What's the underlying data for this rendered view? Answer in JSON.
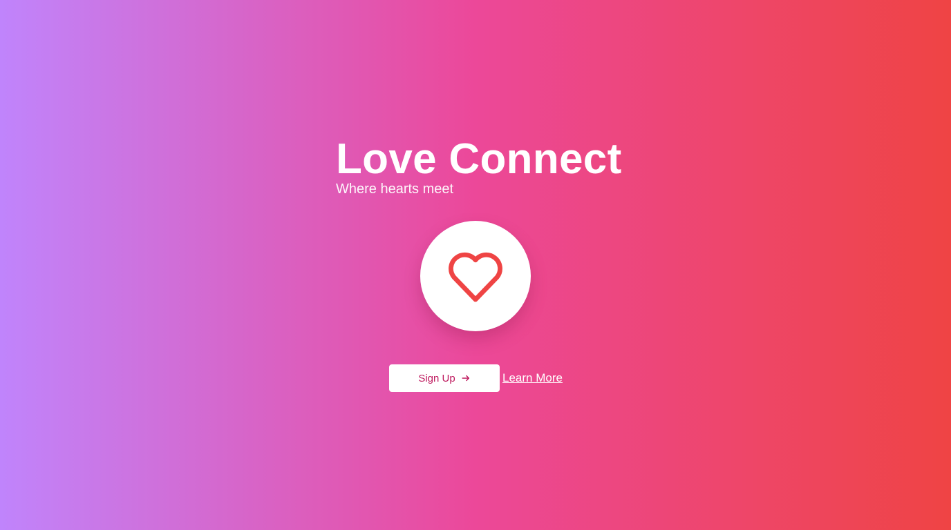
{
  "hero": {
    "title": "Love Connect",
    "subtitle": "Where hearts meet"
  },
  "icons": {
    "heart": "heart-icon",
    "arrow": "arrow-right-icon"
  },
  "actions": {
    "signup_label": "Sign Up",
    "learn_more_label": "Learn More"
  },
  "colors": {
    "gradient_start": "#c084fc",
    "gradient_mid": "#ec4899",
    "gradient_end": "#ef4444",
    "heart_stroke": "#ef4444",
    "signup_text": "#be185d"
  }
}
